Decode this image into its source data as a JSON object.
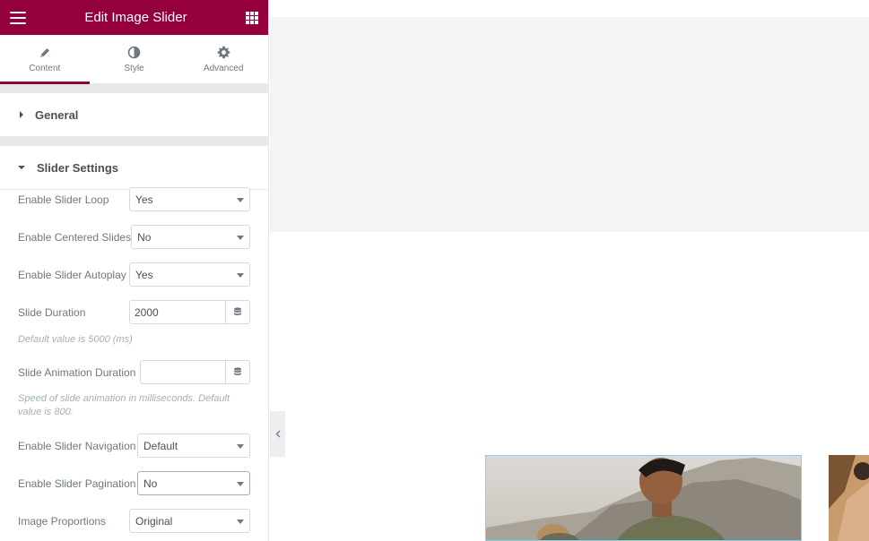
{
  "header": {
    "title": "Edit Image Slider",
    "menu_icon": "hamburger-icon",
    "apps_icon": "grid-icon",
    "brand_color": "#93003c"
  },
  "tabs": [
    {
      "label": "Content",
      "icon": "pencil-icon",
      "active": true
    },
    {
      "label": "Style",
      "icon": "half-circle-icon",
      "active": false
    },
    {
      "label": "Advanced",
      "icon": "gear-icon",
      "active": false
    }
  ],
  "sections": {
    "general": {
      "label": "General",
      "expanded": false
    },
    "slider_settings": {
      "label": "Slider Settings",
      "expanded": true
    }
  },
  "controls": {
    "loop": {
      "label": "Enable Slider Loop",
      "value": "Yes"
    },
    "centered": {
      "label": "Enable Centered Slides",
      "value": "No"
    },
    "autoplay": {
      "label": "Enable Slider Autoplay",
      "value": "Yes"
    },
    "duration": {
      "label": "Slide Duration",
      "value": "2000",
      "description": "Default value is 5000 (ms)"
    },
    "anim_duration": {
      "label": "Slide Animation Duration",
      "value": "",
      "description": "Speed of slide animation in milliseconds. Default value is 800."
    },
    "navigation": {
      "label": "Enable Slider Navigation",
      "value": "Default"
    },
    "pagination": {
      "label": "Enable Slider Pagination",
      "value": "No"
    },
    "proportions": {
      "label": "Image Proportions",
      "value": "Original"
    }
  }
}
